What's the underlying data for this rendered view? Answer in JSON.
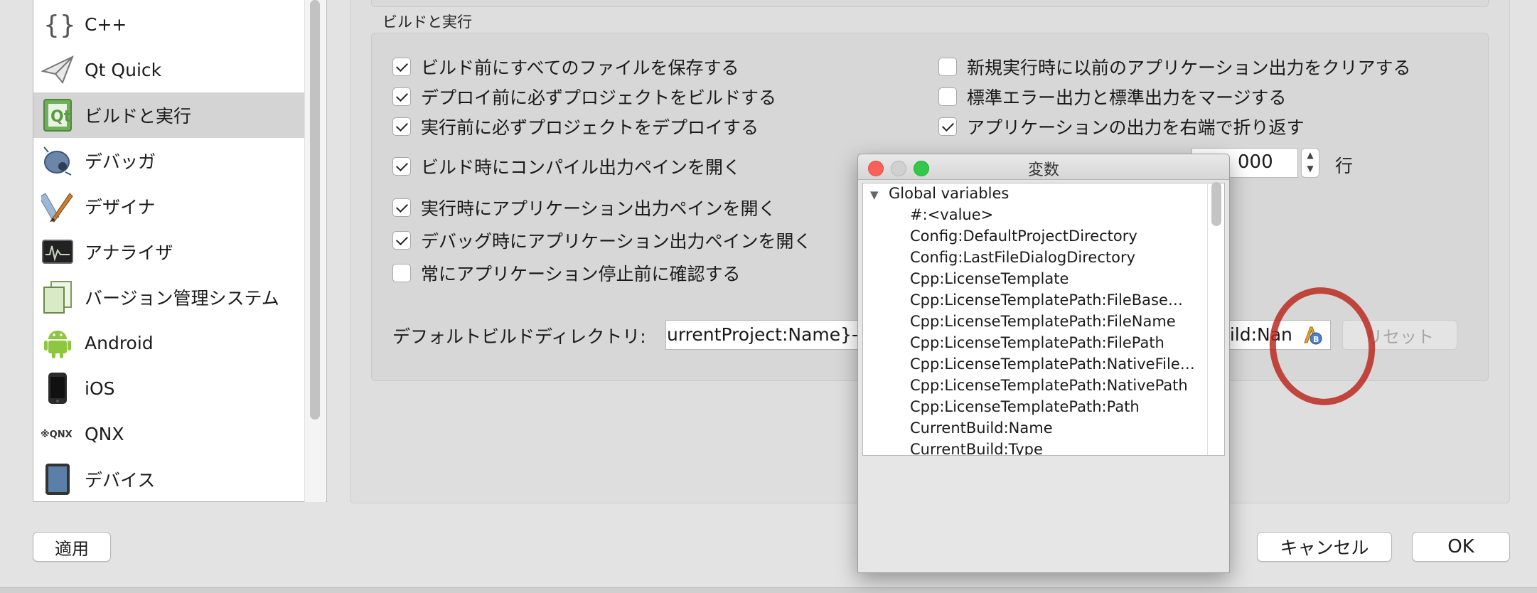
{
  "sidebar": {
    "items": [
      {
        "label": "C++",
        "icon": "cpp-braces-icon"
      },
      {
        "label": "Qt Quick",
        "icon": "paper-plane-icon"
      },
      {
        "label": "ビルドと実行",
        "icon": "qt-build-run-icon"
      },
      {
        "label": "デバッガ",
        "icon": "bug-icon"
      },
      {
        "label": "デザイナ",
        "icon": "designer-tools-icon"
      },
      {
        "label": "アナライザ",
        "icon": "oscilloscope-icon"
      },
      {
        "label": "バージョン管理システム",
        "icon": "documents-icon"
      },
      {
        "label": "Android",
        "icon": "android-icon"
      },
      {
        "label": "iOS",
        "icon": "iphone-icon"
      },
      {
        "label": "QNX",
        "icon": "qnx-logo-icon"
      },
      {
        "label": "デバイス",
        "icon": "tablet-icon"
      }
    ],
    "selected": "ビルドと実行"
  },
  "group": {
    "title": "ビルドと実行",
    "left_checks": [
      {
        "label": "ビルド前にすべてのファイルを保存する",
        "checked": true
      },
      {
        "label": "デプロイ前に必ずプロジェクトをビルドする",
        "checked": true
      },
      {
        "label": "実行前に必ずプロジェクトをデプロイする",
        "checked": true
      },
      {
        "label": "ビルド時にコンパイル出力ペインを開く",
        "checked": true
      },
      {
        "label": "実行時にアプリケーション出力ペインを開く",
        "checked": true
      },
      {
        "label": "デバッグ時にアプリケーション出力ペインを開く",
        "checked": true
      },
      {
        "label": "常にアプリケーション停止前に確認する",
        "checked": false
      }
    ],
    "right_checks": [
      {
        "label": "新規実行時に以前のアプリケーション出力をクリアする",
        "checked": false
      },
      {
        "label": "標準エラー出力と標準出力をマージする",
        "checked": false
      },
      {
        "label": "アプリケーションの出力を右端で折り返す",
        "checked": true
      }
    ],
    "output_limit": {
      "value": "000",
      "unit": "行"
    },
    "build_dir": {
      "label": "デフォルトビルドディレクトリ:",
      "value_visible_left": "urrentProject:Name}-%",
      "value_visible_right": "uild:Nan"
    },
    "reset_label": "リセット"
  },
  "buttons": {
    "apply": "適用",
    "cancel": "キャンセル",
    "ok": "OK"
  },
  "variables_window": {
    "title": "変数",
    "root": "Global variables",
    "items": [
      "#:<value>",
      "Config:DefaultProjectDirectory",
      "Config:LastFileDialogDirectory",
      "Cpp:LicenseTemplate",
      "Cpp:LicenseTemplatePath:FileBase…",
      "Cpp:LicenseTemplatePath:FileName",
      "Cpp:LicenseTemplatePath:FilePath",
      "Cpp:LicenseTemplatePath:NativeFile…",
      "Cpp:LicenseTemplatePath:NativePath",
      "Cpp:LicenseTemplatePath:Path",
      "CurrentBuild:Name",
      "CurrentBuild:Type"
    ]
  },
  "colors": {
    "annotation_circle": "#b8231a",
    "close": "#fc605b",
    "zoom": "#34c84a",
    "selected_row": "#d4d4d4"
  }
}
